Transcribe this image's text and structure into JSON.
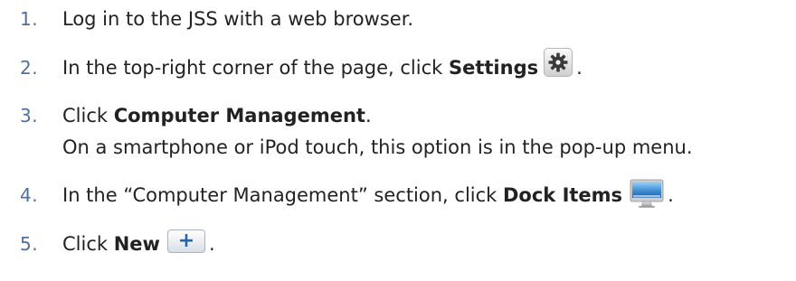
{
  "steps": [
    {
      "number": "1.",
      "text": "Log in to the JSS with a web browser."
    },
    {
      "number": "2.",
      "text_before": "In the top-right corner of the page, click ",
      "bold": "Settings",
      "icon": "gear-icon",
      "text_after": "."
    },
    {
      "number": "3.",
      "text_before": "Click ",
      "bold": "Computer Management",
      "text_after": ".",
      "note": "On a smartphone or iPod touch, this option is in the pop-up menu."
    },
    {
      "number": "4.",
      "text_before": "In the “Computer Management” section, click ",
      "bold": "Dock Items",
      "icon": "monitor-icon",
      "text_after": "."
    },
    {
      "number": "5.",
      "text_before": "Click ",
      "bold": "New",
      "icon": "plus-button-icon",
      "text_after": "."
    }
  ],
  "colors": {
    "step_number": "#4d6fa3",
    "text": "#222222",
    "plus_accent": "#2266b0"
  }
}
